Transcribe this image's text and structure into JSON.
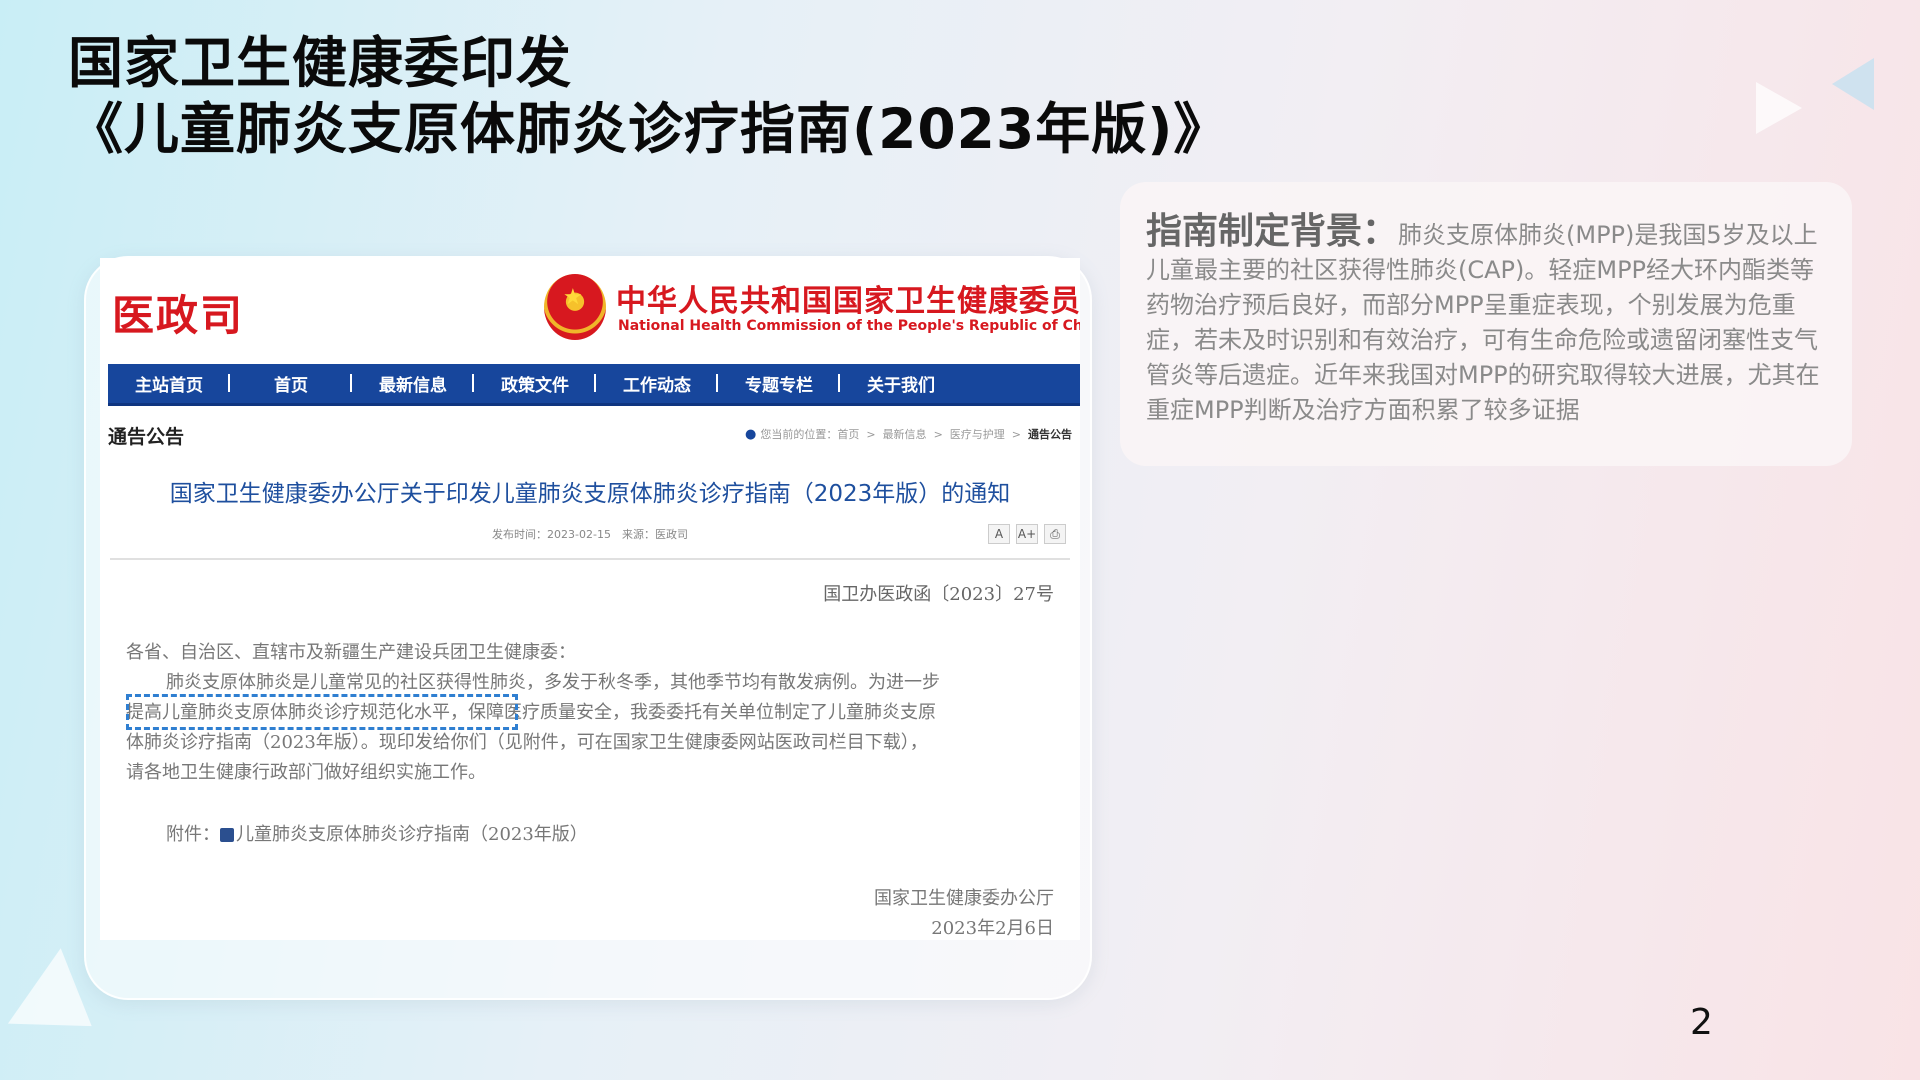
{
  "slide": {
    "title_line1": "国家卫生健康委印发",
    "title_line2": "《儿童肺炎支原体肺炎诊疗指南(2023年版)》",
    "page_number": "2"
  },
  "screenshot": {
    "department": "医政司",
    "org_name_cn": "中华人民共和国国家卫生健康委员会",
    "org_name_en": "National Health Commission of the People's Republic of China",
    "nav_items": [
      "主站首页",
      "首页",
      "最新信息",
      "政策文件",
      "工作动态",
      "专题专栏",
      "关于我们"
    ],
    "section_label": "通告公告",
    "breadcrumb": [
      "您当前的位置：首页",
      "最新信息",
      "医疗与护理",
      "通告公告"
    ],
    "notice_title": "国家卫生健康委办公厅关于印发儿童肺炎支原体肺炎诊疗指南（2023年版）的通知",
    "publish_meta": "发布时间：2023-02-15　来源：医政司",
    "tool_icons": [
      "font-smaller-icon",
      "font-larger-icon",
      "print-icon"
    ],
    "tool_labels": [
      "A",
      "A+",
      "⎙"
    ],
    "doc_number": "国卫办医政函〔2023〕27号",
    "salutation": "各省、自治区、直辖市及新疆生产建设兵团卫生健康委：",
    "body_line1": "肺炎支原体肺炎是儿童常见的社区获得性肺炎，多发于秋冬季，其他季节均有散发病例。为进一步",
    "body_line2": "提高儿童肺炎支原体肺炎诊疗规范化水平，保障医疗质量安全，我委委托有关单位制定了儿童肺炎支原",
    "body_line3": "体肺炎诊疗指南（2023年版）。现印发给你们（见附件，可在国家卫生健康委网站医政司栏目下载），",
    "body_line4": "请各地卫生健康行政部门做好组织实施工作。",
    "attachment_prefix": "附件：",
    "attachment_name": "儿童肺炎支原体肺炎诊疗指南（2023年版）",
    "signer": "国家卫生健康委办公厅",
    "sign_date": "2023年2月6日"
  },
  "info_panel": {
    "heading": "指南制定背景：",
    "text": "肺炎支原体肺炎(MPP)是我国5岁及以上儿童最主要的社区获得性肺炎(CAP)。轻症MPP经大环内酯类等药物治疗预后良好，而部分MPP呈重症表现，个别发展为危重症，若未及时识别和有效治疗，可有生命危险或遗留闭塞性支气管炎等后遗症。近年来我国对MPP的研究取得较大进展，尤其在重症MPP判断及治疗方面积累了较多证据"
  },
  "colors": {
    "accent_red": "#d7181f",
    "nav_blue": "#17469c",
    "highlight_dash": "#2f7fd1"
  }
}
